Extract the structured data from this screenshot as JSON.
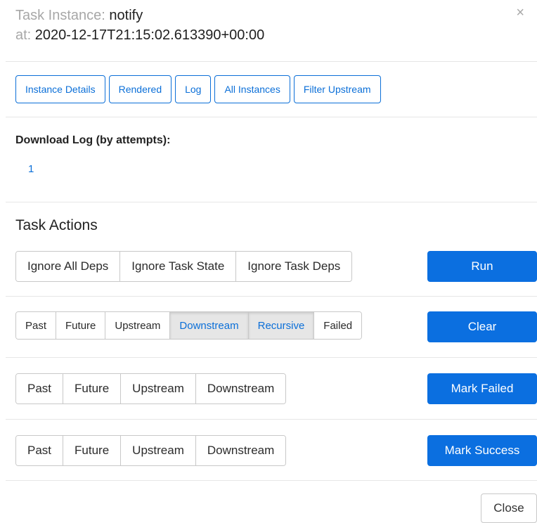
{
  "header": {
    "task_instance_label": "Task Instance: ",
    "task_name": "notify",
    "at_label": "at: ",
    "execution_date": "2020-12-17T21:15:02.613390+00:00",
    "close_symbol": "×"
  },
  "nav": {
    "instance_details": "Instance Details",
    "rendered": "Rendered",
    "log": "Log",
    "all_instances": "All Instances",
    "filter_upstream": "Filter Upstream"
  },
  "download_log": {
    "label": "Download Log (by attempts):",
    "attempts": [
      "1"
    ]
  },
  "task_actions": {
    "title": "Task Actions",
    "run_options": [
      "Ignore All Deps",
      "Ignore Task State",
      "Ignore Task Deps"
    ],
    "run_label": "Run",
    "clear_options": [
      "Past",
      "Future",
      "Upstream",
      "Downstream",
      "Recursive",
      "Failed"
    ],
    "clear_active": [
      "Downstream",
      "Recursive"
    ],
    "clear_label": "Clear",
    "mark_failed_options": [
      "Past",
      "Future",
      "Upstream",
      "Downstream"
    ],
    "mark_failed_label": "Mark Failed",
    "mark_success_options": [
      "Past",
      "Future",
      "Upstream",
      "Downstream"
    ],
    "mark_success_label": "Mark Success"
  },
  "footer": {
    "close_label": "Close"
  },
  "colors": {
    "accent": "#0b6fd8",
    "primary_button": "#0b6fe0",
    "muted_text": "#a7a7a7",
    "active_segment_bg": "#e6e6e6"
  }
}
